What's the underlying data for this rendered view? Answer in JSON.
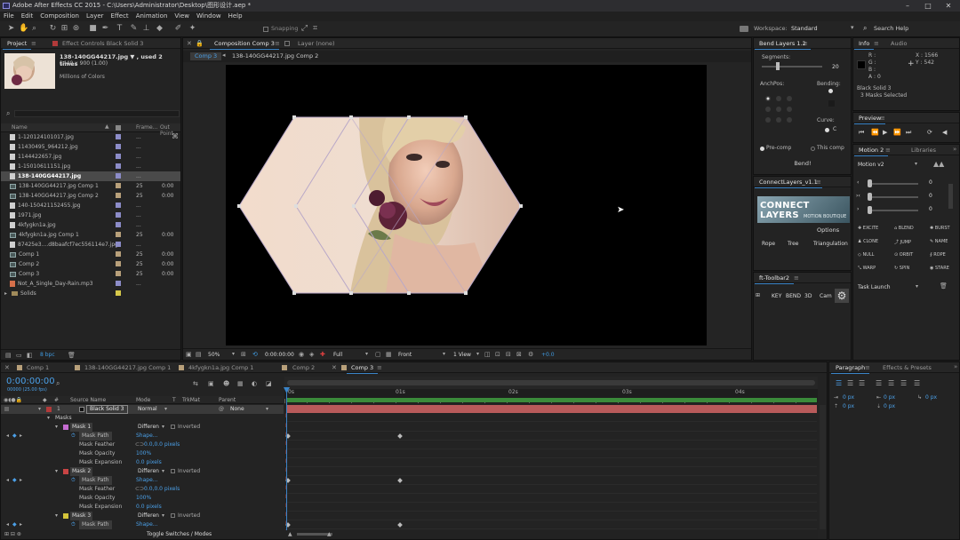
{
  "app": {
    "title": "Adobe After Effects CC 2015 - C:\\Users\\Administrator\\Desktop\\图形设计.aep *"
  },
  "menu": [
    "File",
    "Edit",
    "Composition",
    "Layer",
    "Effect",
    "Animation",
    "View",
    "Window",
    "Help"
  ],
  "toolbar": {
    "snapping": "Snapping",
    "workspace_label": "Workspace:",
    "workspace_value": "Standard",
    "search_help": "Search Help"
  },
  "project": {
    "tab_project": "Project",
    "tab_effects": "Effect Controls Black Solid 3",
    "asset_name": "138-140GG44217.jpg ▼ , used 2 times",
    "asset_dims": "1440 x 900 (1.00)",
    "asset_colors": "Millions of Colors",
    "col_name": "Name",
    "col_frame": "Frame...",
    "col_out": "Out Point",
    "items": [
      {
        "name": "1-120124101017.jpg",
        "type": "file",
        "swatch": "#8c8cc8",
        "frame": "..."
      },
      {
        "name": "11430495_964212.jpg",
        "type": "file",
        "swatch": "#8c8cc8",
        "frame": "..."
      },
      {
        "name": "1144422657.jpg",
        "type": "file",
        "swatch": "#8c8cc8",
        "frame": "..."
      },
      {
        "name": "1-15010611151.jpg",
        "type": "file",
        "swatch": "#8c8cc8",
        "frame": "..."
      },
      {
        "name": "138-140GG44217.jpg",
        "type": "file",
        "swatch": "#8c8cc8",
        "frame": "...",
        "selected": true
      },
      {
        "name": "138-140GG44217.jpg Comp 1",
        "type": "comp",
        "swatch": "#b8a07a",
        "frame": "25",
        "out": "0:00"
      },
      {
        "name": "138-140GG44217.jpg Comp 2",
        "type": "comp",
        "swatch": "#b8a07a",
        "frame": "25",
        "out": "0:00"
      },
      {
        "name": "140-150421152455.jpg",
        "type": "file",
        "swatch": "#8c8cc8",
        "frame": "..."
      },
      {
        "name": "1971.jpg",
        "type": "file",
        "swatch": "#8c8cc8",
        "frame": "..."
      },
      {
        "name": "4kfygkn1a.jpg",
        "type": "file",
        "swatch": "#8c8cc8",
        "frame": "..."
      },
      {
        "name": "4kfygkn1a.jpg Comp 1",
        "type": "comp",
        "swatch": "#b8a07a",
        "frame": "25",
        "out": "0:00"
      },
      {
        "name": "87425e3....d8baafcf7ec556114e7.jpg",
        "type": "file",
        "swatch": "#8c8cc8",
        "frame": "..."
      },
      {
        "name": "Comp 1",
        "type": "comp",
        "swatch": "#b8a07a",
        "frame": "25",
        "out": "0:00"
      },
      {
        "name": "Comp 2",
        "type": "comp",
        "swatch": "#b8a07a",
        "frame": "25",
        "out": "0:00"
      },
      {
        "name": "Comp 3",
        "type": "comp",
        "swatch": "#b8a07a",
        "frame": "25",
        "out": "0:00"
      },
      {
        "name": "Not_A_Single_Day-Rain.mp3",
        "type": "audio",
        "swatch": "#8c8cc8",
        "frame": "..."
      },
      {
        "name": "Solids",
        "type": "folder",
        "swatch": "#d6c84a",
        "frame": ""
      }
    ],
    "bpc": "8 bpc"
  },
  "composition": {
    "tab_comp": "Composition Comp 3",
    "tab_layer": "Layer (none)",
    "crumb1": "Comp 3",
    "crumb2": "138-140GG44217.jpg Comp 2",
    "zoom": "50%",
    "timecode": "0:00:00:00",
    "resolution": "Full",
    "view": "Front",
    "views": "1 View",
    "exposure": "+0.0"
  },
  "bend": {
    "title": "Bend Layers 1.2",
    "segments_label": "Segments:",
    "segments_value": "20",
    "anchpos_label": "AnchPos:",
    "bending_label": "Bending:",
    "curve_label": "Curve:",
    "curve_value": "C",
    "precomp": "Pre-comp",
    "thiscomp": "This comp",
    "bend_btn": "Bend!"
  },
  "connect": {
    "title": "ConnectLayers_v1.1",
    "banner_title": "CONNECT LAYERS",
    "banner_sub": "MOTION BOUTIQUE",
    "options": "Options",
    "rope": "Rope",
    "tree": "Tree",
    "triangulation": "Triangulation"
  },
  "fttoolbar": {
    "title": "ft-Toolbar2",
    "buttons": [
      "KEY",
      "BEND",
      "3D",
      "Cam"
    ]
  },
  "info": {
    "tab_info": "Info",
    "tab_audio": "Audio",
    "r": "R :",
    "g": "G :",
    "b": "B :",
    "a": "A : 0",
    "x": "X : 1566",
    "y": "Y : 542",
    "layer": "Black Solid 3",
    "masks": "3 Masks Selected"
  },
  "preview": {
    "title": "Preview"
  },
  "motion": {
    "tab_motion": "Motion 2",
    "tab_libraries": "Libraries",
    "version": "Motion v2",
    "val1": "0",
    "val2": "0",
    "val3": "0",
    "buttons": [
      "EXCITE",
      "BLEND",
      "BURST",
      "CLONE",
      "JUMP",
      "NAME",
      "NULL",
      "ORBIT",
      "ROPE",
      "WARP",
      "SPIN",
      "STARE"
    ],
    "task": "Task Launch"
  },
  "timeline": {
    "tabs": [
      "Comp 1",
      "138-140GG44217.jpg Comp 1",
      "4kfygkn1a.jpg Comp 1",
      "Comp 2",
      "Comp 3"
    ],
    "timecode": "0:00:00:00",
    "fps": "00000 (25.00 fps)",
    "col_source": "Source Name",
    "col_mode": "Mode",
    "col_t": "T",
    "col_trkmat": "TrkMat",
    "col_parent": "Parent",
    "layer_num": "1",
    "layer_name": "Black Solid 3",
    "layer_mode": "Normal",
    "layer_parent": "None",
    "masks_label": "Masks",
    "mask1": "Mask 1",
    "mask2": "Mask 2",
    "mask3": "Mask 3",
    "mask_mode": "Differen",
    "inverted": "Inverted",
    "mask_path": "Mask Path",
    "mask_feather": "Mask Feather",
    "mask_opacity": "Mask Opacity",
    "mask_expansion": "Mask Expansion",
    "shape": "Shape...",
    "feather_val": "0.0,0.0 pixels",
    "opacity_val": "100%",
    "expansion_val": "0.0 pixels",
    "ruler": [
      "0s",
      "01s",
      "02s",
      "03s",
      "04s"
    ],
    "toggle": "Toggle Switches / Modes"
  },
  "paragraph": {
    "tab_paragraph": "Paragraph",
    "tab_effects": "Effects & Presets",
    "px": "0 px"
  }
}
